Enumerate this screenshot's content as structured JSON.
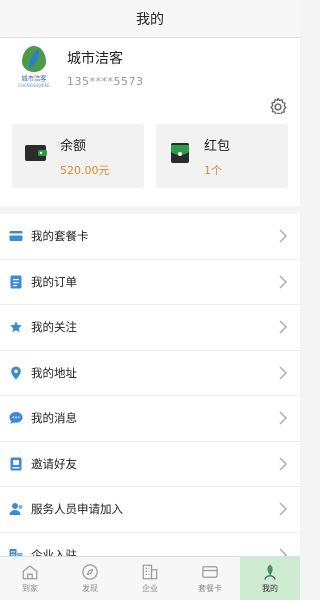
{
  "header": {
    "title": "我的"
  },
  "profile": {
    "brand_name": "城市洁客",
    "brand_sub": "CHENGSHIJIEKE",
    "name": "城市洁客",
    "phone": "135****5573",
    "settings_icon": "gear-icon"
  },
  "cards": [
    {
      "title": "余额",
      "value": "520.00元",
      "icon": "wallet-icon"
    },
    {
      "title": "红包",
      "value": "1个",
      "icon": "red-packet-icon"
    }
  ],
  "menu": [
    {
      "label": "我的套餐卡",
      "icon": "card-icon"
    },
    {
      "label": "我的订单",
      "icon": "order-icon"
    },
    {
      "label": "我的关注",
      "icon": "star-icon"
    },
    {
      "label": "我的地址",
      "icon": "location-icon"
    },
    {
      "label": "我的消息",
      "icon": "message-icon"
    },
    {
      "label": "邀请好友",
      "icon": "invite-icon"
    },
    {
      "label": "服务人员申请加入",
      "icon": "staff-icon"
    },
    {
      "label": "企业入驻",
      "icon": "enterprise-icon"
    }
  ],
  "tabs": [
    {
      "label": "到家",
      "icon": "home-icon",
      "active": false
    },
    {
      "label": "发现",
      "icon": "compass-icon",
      "active": false
    },
    {
      "label": "企业",
      "icon": "building-icon",
      "active": false
    },
    {
      "label": "套餐卡",
      "icon": "card-icon",
      "active": false
    },
    {
      "label": "我的",
      "icon": "profile-icon",
      "active": true
    }
  ],
  "colors": {
    "accent_blue": "#3a8ad6",
    "value_orange": "#e08a2c",
    "wallet_green": "#2e9a48",
    "active_tab_bg": "#cdebd0"
  }
}
